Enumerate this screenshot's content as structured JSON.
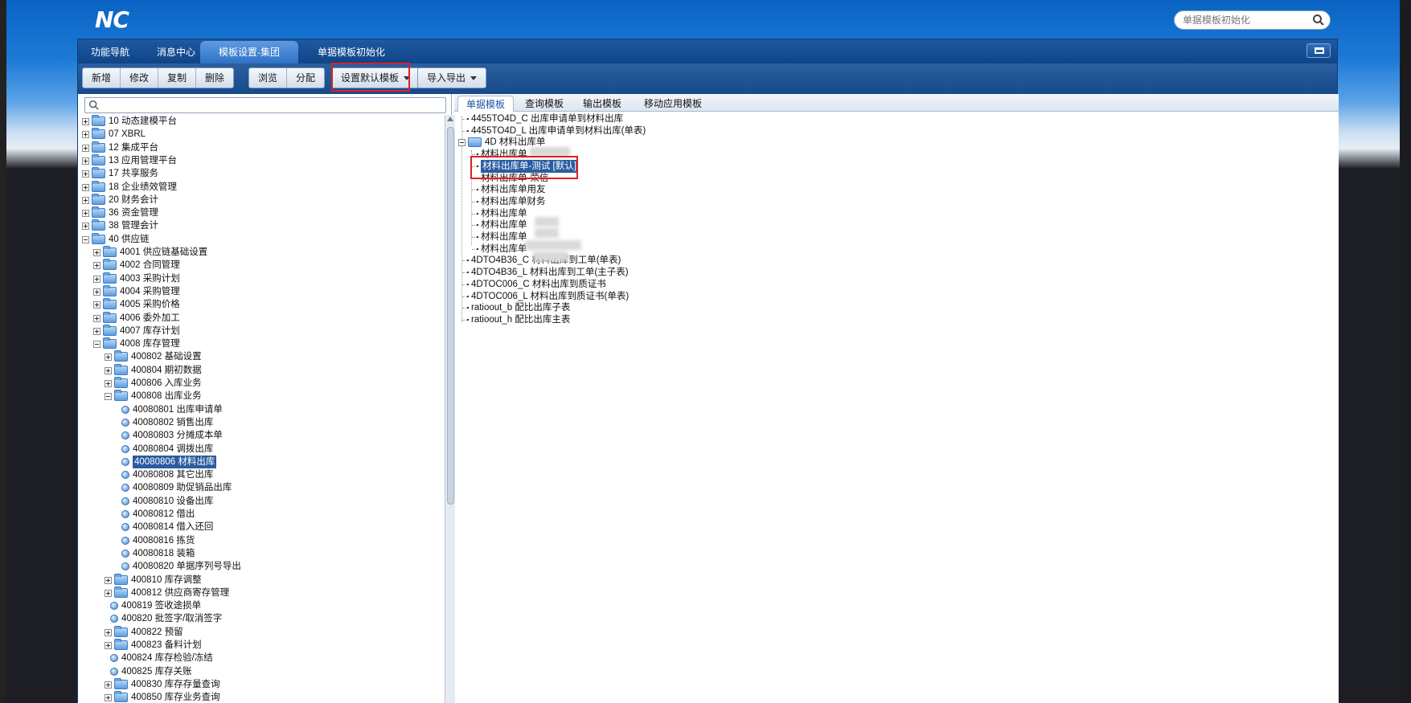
{
  "app": {
    "logo": "NC"
  },
  "search": {
    "placeholder": "单据模板初始化"
  },
  "tabs": [
    {
      "label": "功能导航"
    },
    {
      "label": "消息中心"
    },
    {
      "label": "模板设置-集团"
    },
    {
      "label": "单据模板初始化"
    }
  ],
  "toolbar": {
    "group1": [
      "新增",
      "修改",
      "复制",
      "删除"
    ],
    "group2": [
      "浏览",
      "分配"
    ],
    "set_default": "设置默认模板",
    "import_export": "导入导出"
  },
  "left_tree": [
    {
      "code": "10",
      "name": "动态建模平台"
    },
    {
      "code": "07",
      "name": "XBRL"
    },
    {
      "code": "12",
      "name": "集成平台"
    },
    {
      "code": "13",
      "name": "应用管理平台"
    },
    {
      "code": "17",
      "name": "共享服务"
    },
    {
      "code": "18",
      "name": "企业绩效管理"
    },
    {
      "code": "20",
      "name": "财务会计"
    },
    {
      "code": "36",
      "name": "资金管理"
    },
    {
      "code": "38",
      "name": "管理会计"
    },
    {
      "code": "40",
      "name": "供应链"
    },
    {
      "code": "4001",
      "name": "供应链基础设置"
    },
    {
      "code": "4002",
      "name": "合同管理"
    },
    {
      "code": "4003",
      "name": "采购计划"
    },
    {
      "code": "4004",
      "name": "采购管理"
    },
    {
      "code": "4005",
      "name": "采购价格"
    },
    {
      "code": "4006",
      "name": "委外加工"
    },
    {
      "code": "4007",
      "name": "库存计划"
    },
    {
      "code": "4008",
      "name": "库存管理"
    },
    {
      "code": "400802",
      "name": "基础设置"
    },
    {
      "code": "400804",
      "name": "期初数据"
    },
    {
      "code": "400806",
      "name": "入库业务"
    },
    {
      "code": "400808",
      "name": "出库业务"
    },
    {
      "code": "40080801",
      "name": "出库申请单"
    },
    {
      "code": "40080802",
      "name": "销售出库"
    },
    {
      "code": "40080803",
      "name": "分摊成本单"
    },
    {
      "code": "40080804",
      "name": "调拨出库"
    },
    {
      "code": "40080806",
      "name": "材料出库"
    },
    {
      "code": "40080808",
      "name": "其它出库"
    },
    {
      "code": "40080809",
      "name": "助促销品出库"
    },
    {
      "code": "40080810",
      "name": "设备出库"
    },
    {
      "code": "40080812",
      "name": "借出"
    },
    {
      "code": "40080814",
      "name": "借入还回"
    },
    {
      "code": "40080816",
      "name": "拣货"
    },
    {
      "code": "40080818",
      "name": "装箱"
    },
    {
      "code": "40080820",
      "name": "单据序列号导出"
    },
    {
      "code": "400810",
      "name": "库存调整"
    },
    {
      "code": "400812",
      "name": "供应商寄存管理"
    },
    {
      "code": "400819",
      "name": "签收途损单"
    },
    {
      "code": "400820",
      "name": "批签字/取消签字"
    },
    {
      "code": "400822",
      "name": "预留"
    },
    {
      "code": "400823",
      "name": "备料计划"
    },
    {
      "code": "400824",
      "name": "库存检验/冻结"
    },
    {
      "code": "400825",
      "name": "库存关账"
    },
    {
      "code": "400830",
      "name": "库存存量查询"
    },
    {
      "code": "400850",
      "name": "库存业务查询"
    }
  ],
  "right_tabs": [
    "单据模板",
    "查询模板",
    "输出模板",
    "移动应用模板"
  ],
  "right_tree": [
    "4455TO4D_C 出库申请单到材料出库",
    "4455TO4D_L 出库申请单到材料出库(单表)",
    "4D 材料出库单",
    "材料出库单",
    "材料出库单-测试 [默认]",
    "材料出库单-荣信",
    "材料出库单用友",
    "材料出库单财务",
    "材料出库单",
    "材料出库单",
    "材料出库单",
    "材料出库单",
    "4DTO4B36_C 材料出库到工单(单表)",
    "4DTO4B36_L 材料出库到工单(主子表)",
    "4DTOC006_C 材料出库到质证书",
    "4DTOC006_L 材料出库到质证书(单表)",
    "ratioout_b 配比出库子表",
    "ratioout_h 配比出库主表"
  ]
}
